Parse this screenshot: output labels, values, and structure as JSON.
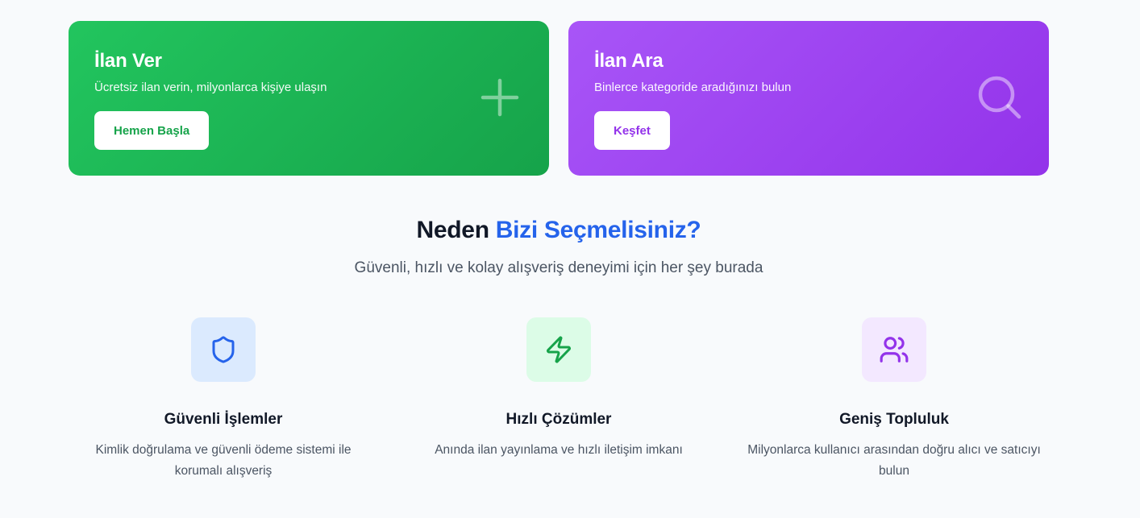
{
  "cta": {
    "post_ad": {
      "title": "İlan Ver",
      "description": "Ücretsiz ilan verin, milyonlarca kişiye ulaşın",
      "button_label": "Hemen Başla",
      "icon": "plus-icon"
    },
    "search_ad": {
      "title": "İlan Ara",
      "description": "Binlerce kategoride aradığınızı bulun",
      "button_label": "Keşfet",
      "icon": "search-icon"
    }
  },
  "why_us": {
    "title_prefix": "Neden",
    "title_accent": "Bizi Seçmelisiniz?",
    "subtitle": "Güvenli, hızlı ve kolay alışveriş deneyimi için her şey burada",
    "features": [
      {
        "title": "Güvenli İşlemler",
        "description": "Kimlik doğrulama ve güvenli ödeme sistemi ile korumalı alışveriş",
        "icon": "shield-icon"
      },
      {
        "title": "Hızlı Çözümler",
        "description": "Anında ilan yayınlama ve hızlı iletişim imkanı",
        "icon": "lightning-icon"
      },
      {
        "title": "Geniş Topluluk",
        "description": "Milyonlarca kullanıcı arasından doğru alıcı ve satıcıyı bulun",
        "icon": "users-icon"
      }
    ]
  },
  "colors": {
    "green": "#22c55e",
    "purple": "#a855f7",
    "accent_blue": "#2563eb"
  }
}
